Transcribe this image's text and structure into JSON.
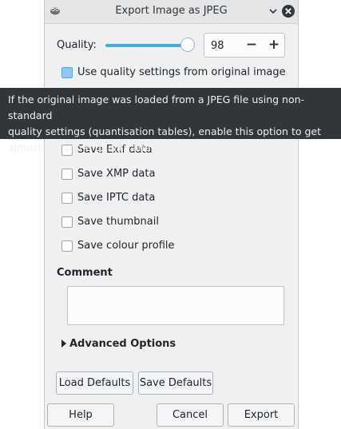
{
  "window": {
    "title": "Export Image as JPEG"
  },
  "quality": {
    "label": "Quality:",
    "value": "98",
    "slider_fraction": 0.98,
    "minus": "−",
    "plus": "+"
  },
  "use_quality_settings": {
    "label": "Use quality settings from original image",
    "checked": false
  },
  "tooltip": {
    "lines": [
      "If the original image was loaded from a JPEG file using non-standard",
      "quality settings (quantisation tables), enable this option to get",
      "almost the same quality and file size."
    ]
  },
  "options": [
    {
      "label": "Save Exif data",
      "checked": false
    },
    {
      "label": "Save XMP data",
      "checked": false
    },
    {
      "label": "Save IPTC data",
      "checked": false
    },
    {
      "label": "Save thumbnail",
      "checked": false
    },
    {
      "label": "Save colour profile",
      "checked": false
    }
  ],
  "comment": {
    "label": "Comment",
    "value": ""
  },
  "advanced": {
    "label": "Advanced Options",
    "expanded": false
  },
  "buttons": {
    "load_defaults": "Load Defaults",
    "save_defaults": "Save Defaults",
    "help": "Help",
    "cancel": "Cancel",
    "export": "Export"
  },
  "colors": {
    "accent": "#3daee9",
    "window_bg": "#eff0f1",
    "tooltip_bg": "#31363b"
  }
}
